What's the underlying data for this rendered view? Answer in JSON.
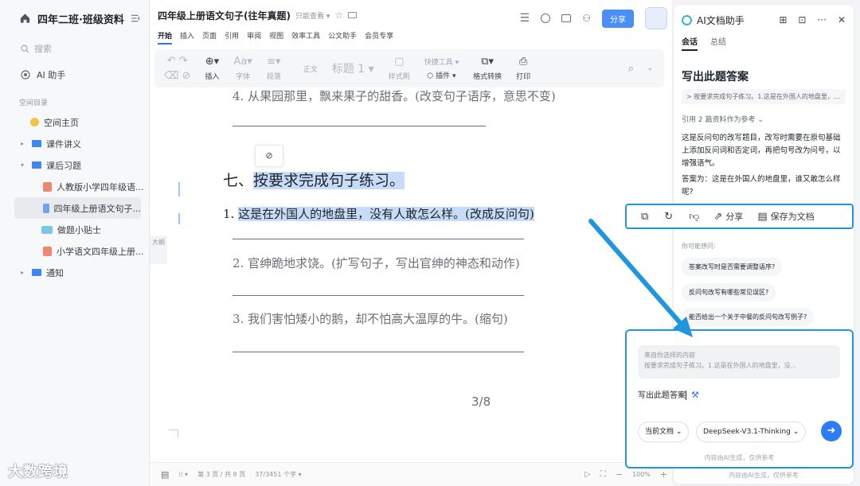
{
  "sidebar": {
    "workspace_title": "四年二班·班级资料",
    "search_placeholder": "搜索",
    "ai_assistant": "AI 助手",
    "section_label": "空间目录",
    "items": [
      {
        "label": "空间主页"
      },
      {
        "label": "课件讲义"
      },
      {
        "label": "课后习题"
      },
      {
        "label": "人教版小学四年级语..."
      },
      {
        "label": "四年级上册语文句子..."
      },
      {
        "label": "做题小贴士"
      },
      {
        "label": "小学语文四年级上册..."
      },
      {
        "label": "通知"
      }
    ],
    "watermark": "大数跨境"
  },
  "document": {
    "title": "四年级上册语文句子(往年真题)",
    "permission": "只能查看",
    "share_label": "分享",
    "menu": [
      "开始",
      "插入",
      "页面",
      "引用",
      "审阅",
      "视图",
      "效率工具",
      "公文助手",
      "会员专享"
    ],
    "ribbon": {
      "insert": "插入",
      "font": "字体",
      "paragraph": "段落",
      "body_style": "正文",
      "heading": "标题 1",
      "style_brush": "样式刷",
      "quick_tools": "快捷工具",
      "plugins": "插件",
      "format_convert": "格式转换",
      "print": "打印"
    },
    "outline_tab": "大纲",
    "content": {
      "line4": "4. 从果园那里，飘来果子的甜香。(改变句子语序，意思不变)",
      "section_prefix": "七、",
      "section_title": "按要求完成句子练习。",
      "q1_num": "1.",
      "q1_text": "这是在外国人的地盘里，没有人敢怎么样。(改成反问句)",
      "q2": "2. 官绅跪地求饶。(扩写句子，写出官绅的神态和动作)",
      "q3": "3. 我们害怕矮小的鹅，却不怕高大温厚的牛。(缩句)",
      "page_number": "3/8"
    },
    "status": {
      "page_info": "第 3 页 / 共 8 页",
      "word_count": "37/3451 个字",
      "zoom": "100%"
    }
  },
  "ai_panel": {
    "title": "AI文档助手",
    "tabs": [
      "会话",
      "总结"
    ],
    "question": "写出此题答案",
    "quote": "> 按要求完成句子练习。1.这是在外国人的地盘里，没有人敢怎么样。",
    "ref_label": "引用 2 篇资料作为参考",
    "answer_p1": "这是反问句的改写题目，改写时需要在原句基础上添加反问词和否定词，再把句号改为问号，以增强语气。",
    "answer_p2": "答案为：这是在外国人的地盘里，谁又敢怎么样呢?",
    "actions": {
      "share": "分享",
      "save_doc": "保存为文档"
    },
    "suggest_title": "你可能想问:",
    "suggestions": [
      "答案改写时是否需要调整语序?",
      "反问句改写有哪些常见误区?",
      "能否给出一个关于中餐的反问句改写例子?"
    ],
    "input": {
      "context_label": "来自你选择的内容",
      "context_text": "按要求完成句子练习。1.这是在外国人的地盘里，没...",
      "typed_text": "写出此题答案",
      "scope": "当前文档",
      "model": "DeepSeek-V3.1-Thinking",
      "disclaimer": "内容由AI生成，仅供参考"
    },
    "footer_disclaimer": "内容由AI生成，仅供参考"
  },
  "colors": {
    "accent": "#3370ff",
    "highlight_box": "#2196e0",
    "selection": "#c6dcf8",
    "send_button": "#2d7cf6"
  }
}
